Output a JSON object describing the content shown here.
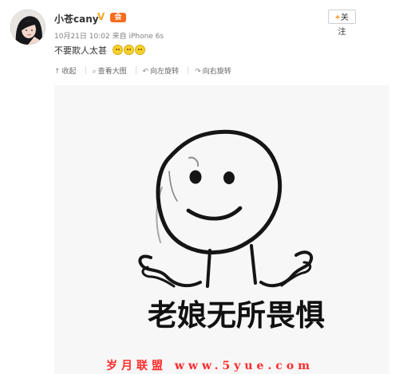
{
  "post": {
    "username": "小苍cany",
    "verified_badge": "V",
    "membership_badge": "会",
    "timestamp": "10月21日 10:02",
    "source_prefix": "来自",
    "source_device": "iPhone 6s",
    "follow_label": "关注",
    "text": "不要欺人太甚",
    "emoji_icons": [
      "smile-emoji",
      "smile-emoji",
      "smile-emoji"
    ]
  },
  "toolbar": {
    "collapse_label": "收起",
    "view_large_label": "查看大图",
    "rotate_left_label": "向左旋转",
    "rotate_right_label": "向右旋转"
  },
  "image": {
    "caption": "老娘无所畏惧"
  },
  "watermark": {
    "text": "岁月联盟 www.5yue.com"
  },
  "colors": {
    "accent_orange": "#ff8200",
    "verified_gold": "#f5a623",
    "vip_orange": "#f86b1d",
    "watermark_red": "#ff2b2b"
  }
}
